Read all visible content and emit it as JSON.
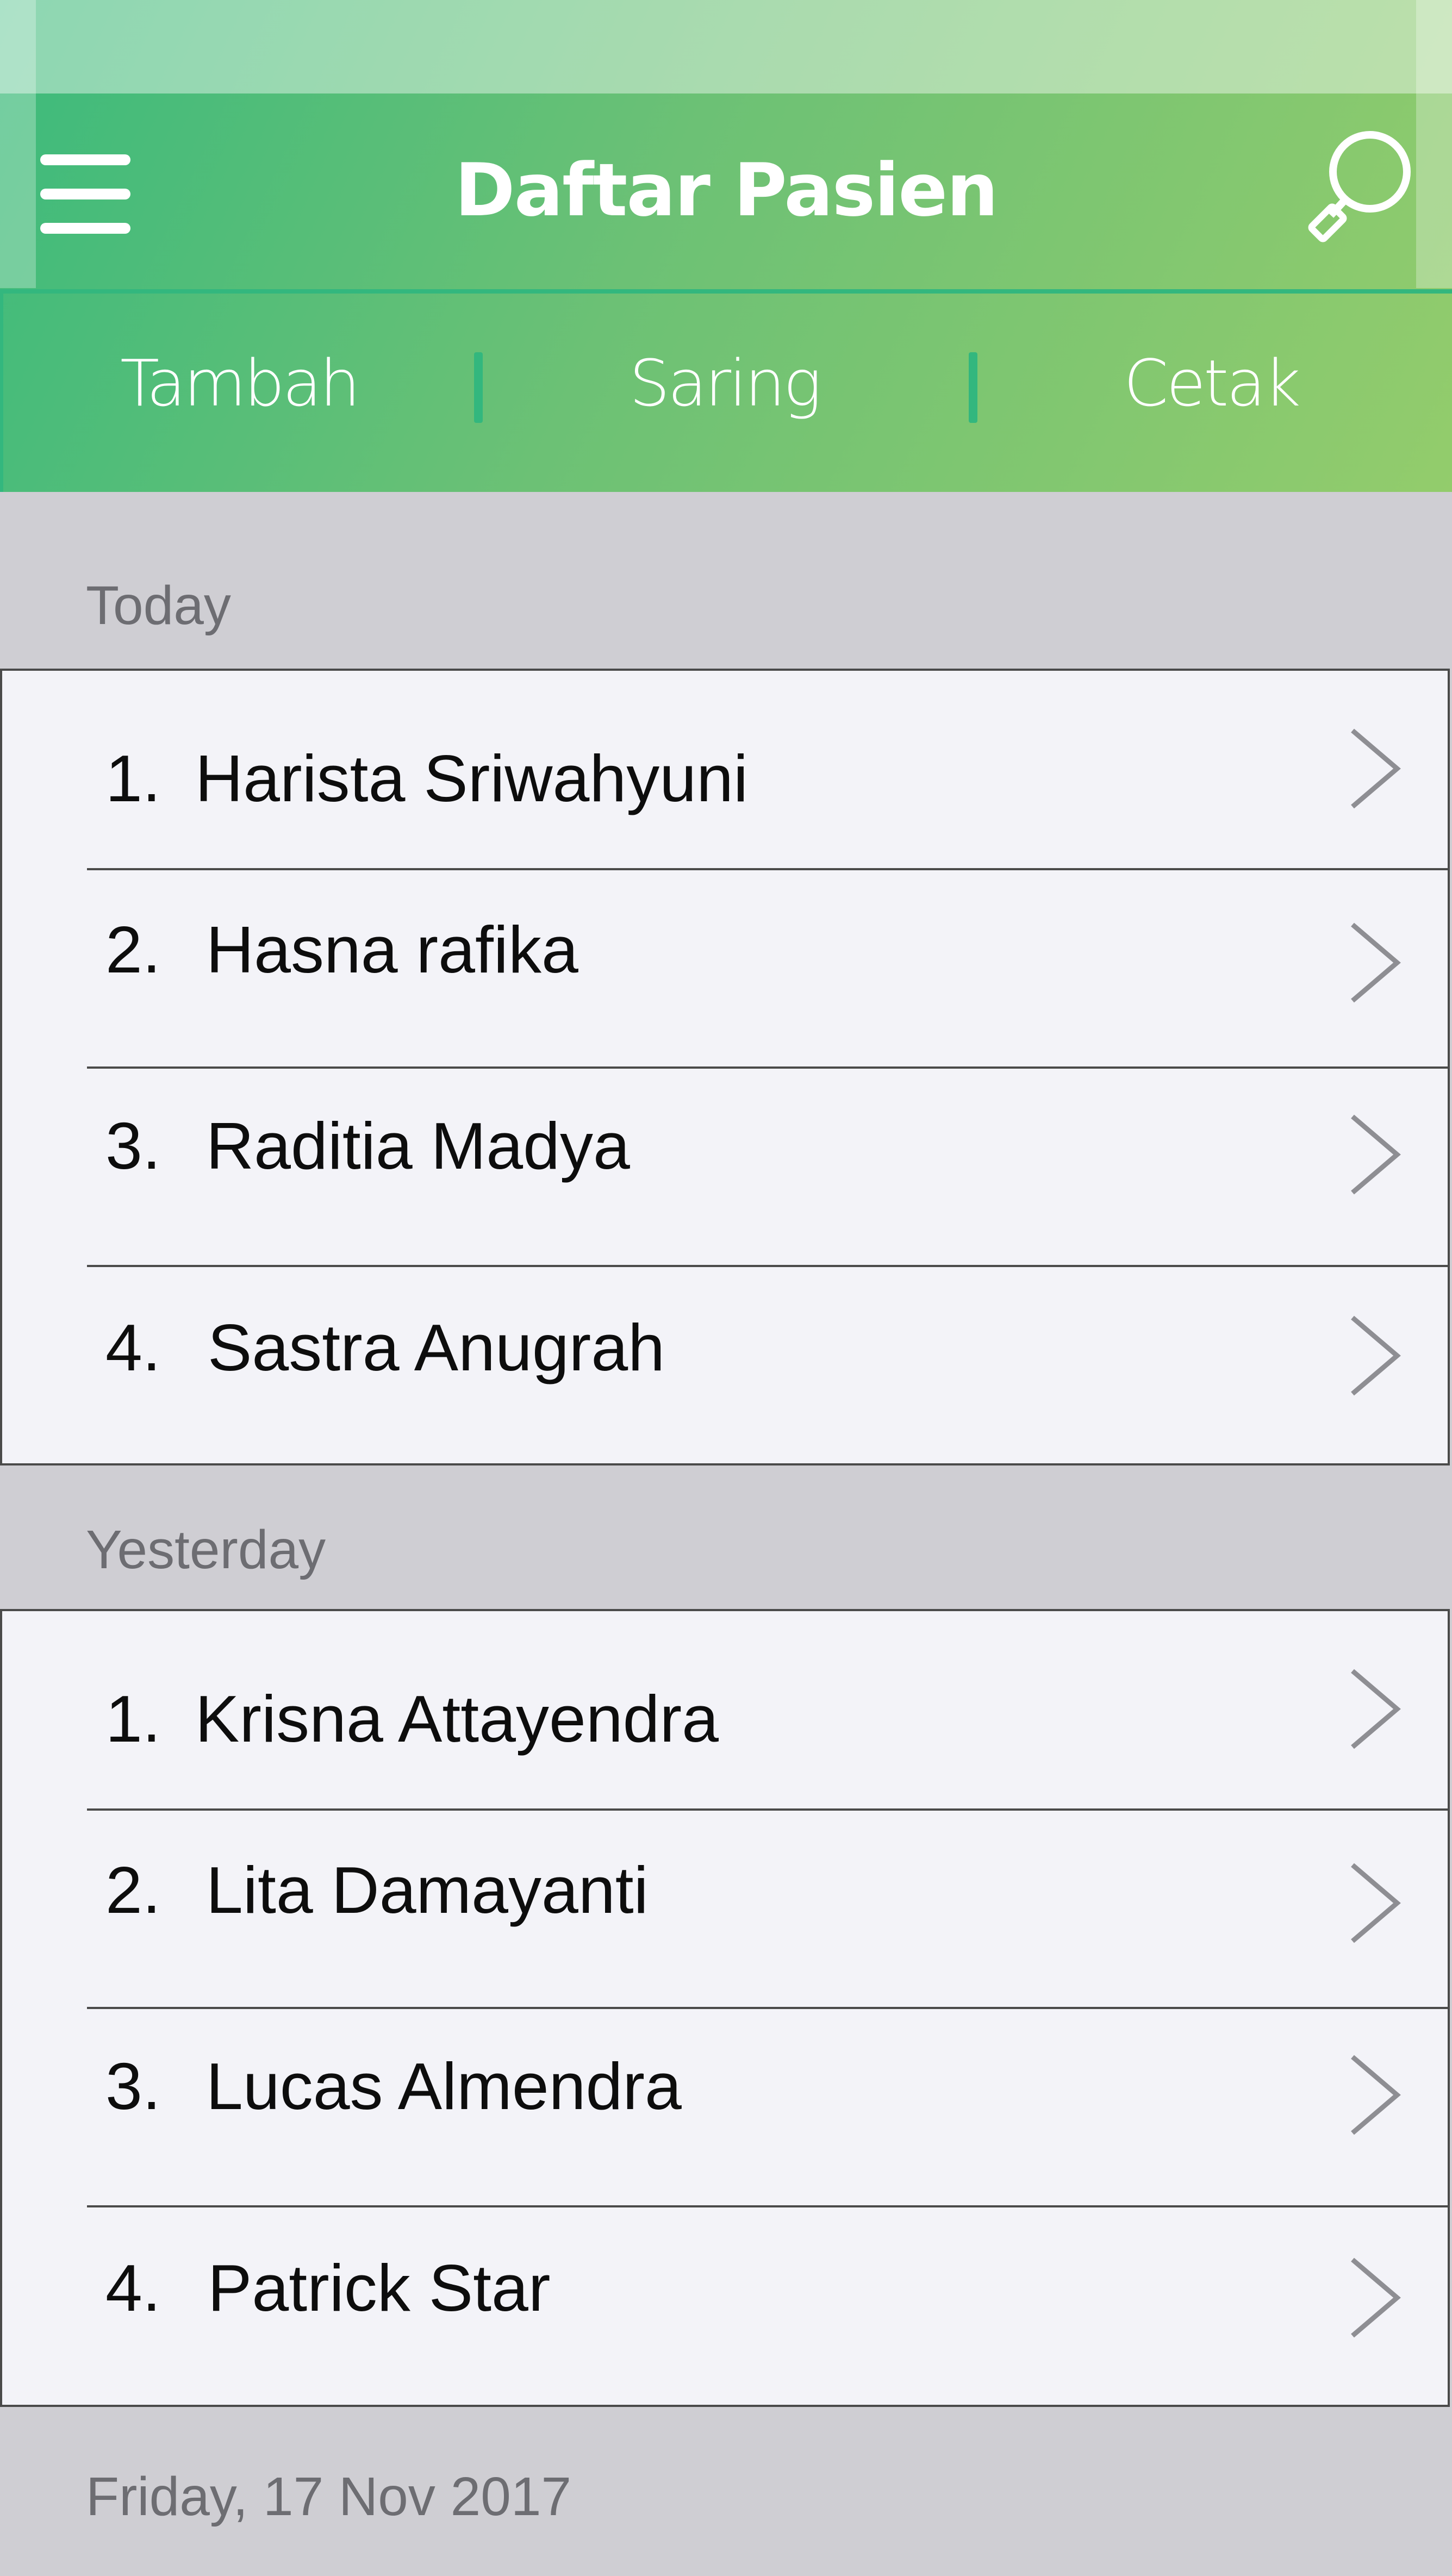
{
  "header": {
    "title": "Daftar Pasien",
    "menu_icon": "hamburger-menu-icon",
    "search_icon": "magnifier-search-icon",
    "colors": {
      "gradient_start": "#3cba7c",
      "gradient_end": "#93cc6c",
      "divider": "#33b77e",
      "text": "#ffffff"
    }
  },
  "segments": [
    {
      "label": "Tambah"
    },
    {
      "label": "Saring"
    },
    {
      "label": "Cetak"
    }
  ],
  "sections": [
    {
      "label": "Today",
      "rows": [
        {
          "number": "1.",
          "name": "Harista Sriwahyuni"
        },
        {
          "number": "2.",
          "name": "Hasna rafika"
        },
        {
          "number": "3.",
          "name": "Raditia Madya"
        },
        {
          "number": "4.",
          "name": "Sastra Anugrah"
        }
      ]
    },
    {
      "label": "Yesterday",
      "rows": [
        {
          "number": "1.",
          "name": "Krisna Attayendra"
        },
        {
          "number": "2.",
          "name": "Lita Damayanti"
        },
        {
          "number": "3.",
          "name": "Lucas Almendra"
        },
        {
          "number": "4.",
          "name": "Patrick Star"
        }
      ]
    },
    {
      "label": "Friday, 17 Nov 2017",
      "rows": []
    }
  ],
  "row_chevron_icon": "chevron-right-icon",
  "colors": {
    "list_background": "#f3f3f8",
    "section_background": "#cfced3",
    "section_text": "#6d6d72",
    "row_text": "#0d0d0d",
    "chevron": "#8e8e93"
  }
}
